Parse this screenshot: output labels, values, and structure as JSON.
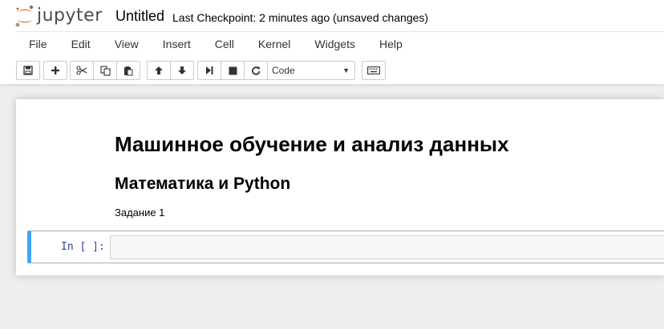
{
  "app": {
    "logo_text": "jupyter"
  },
  "notebook": {
    "name": "Untitled",
    "checkpoint": "Last Checkpoint: 2 minutes ago (unsaved changes)"
  },
  "menu": [
    "File",
    "Edit",
    "View",
    "Insert",
    "Cell",
    "Kernel",
    "Widgets",
    "Help"
  ],
  "toolbar": {
    "cell_type": "Code",
    "buttons": [
      "save-icon",
      "plus-icon",
      "cut-icon",
      "copy-icon",
      "paste-icon",
      "arrow-up-icon",
      "arrow-down-icon",
      "run-icon",
      "stop-icon",
      "restart-icon",
      "keyboard-icon"
    ]
  },
  "cells": {
    "heading1": "Машинное обучение и анализ данных",
    "heading2": "Математика и Python",
    "paragraph": "Задание 1",
    "code_prompt": "In [ ]:",
    "code_value": ""
  },
  "colors": {
    "logo_orange": "#f37726",
    "logo_gray": "#616262",
    "cell_selected_border": "#42a5f5",
    "prompt_color": "#303f9f"
  }
}
